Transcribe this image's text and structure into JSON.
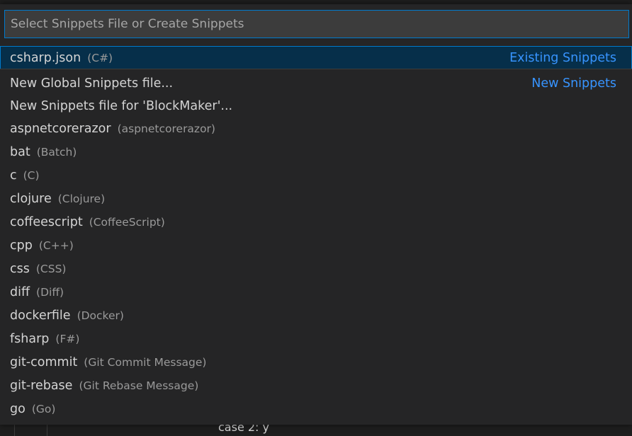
{
  "quickpick": {
    "placeholder": "Select Snippets File or Create Snippets",
    "items": [
      {
        "label": "csharp.json",
        "description": "(C#)",
        "group_label": "Existing Snippets"
      },
      {
        "label": "New Global Snippets file...",
        "description": "",
        "group_label": "New Snippets"
      },
      {
        "label": "New Snippets file for 'BlockMaker'...",
        "description": "",
        "group_label": ""
      },
      {
        "label": "aspnetcorerazor",
        "description": "(aspnetcorerazor)",
        "group_label": ""
      },
      {
        "label": "bat",
        "description": "(Batch)",
        "group_label": ""
      },
      {
        "label": "c",
        "description": "(C)",
        "group_label": ""
      },
      {
        "label": "clojure",
        "description": "(Clojure)",
        "group_label": ""
      },
      {
        "label": "coffeescript",
        "description": "(CoffeeScript)",
        "group_label": ""
      },
      {
        "label": "cpp",
        "description": "(C++)",
        "group_label": ""
      },
      {
        "label": "css",
        "description": "(CSS)",
        "group_label": ""
      },
      {
        "label": "diff",
        "description": "(Diff)",
        "group_label": ""
      },
      {
        "label": "dockerfile",
        "description": "(Docker)",
        "group_label": ""
      },
      {
        "label": "fsharp",
        "description": "(F#)",
        "group_label": ""
      },
      {
        "label": "git-commit",
        "description": "(Git Commit Message)",
        "group_label": ""
      },
      {
        "label": "git-rebase",
        "description": "(Git Rebase Message)",
        "group_label": ""
      },
      {
        "label": "go",
        "description": "(Go)",
        "group_label": ""
      }
    ]
  },
  "editor": {
    "fragment": "case 2: y"
  },
  "colors": {
    "background": "#252526",
    "selection": "#062f4a",
    "focus_border": "#007acc",
    "group_label": "#3794ff",
    "text": "#d4d4d4",
    "description": "#9a9a9a"
  }
}
